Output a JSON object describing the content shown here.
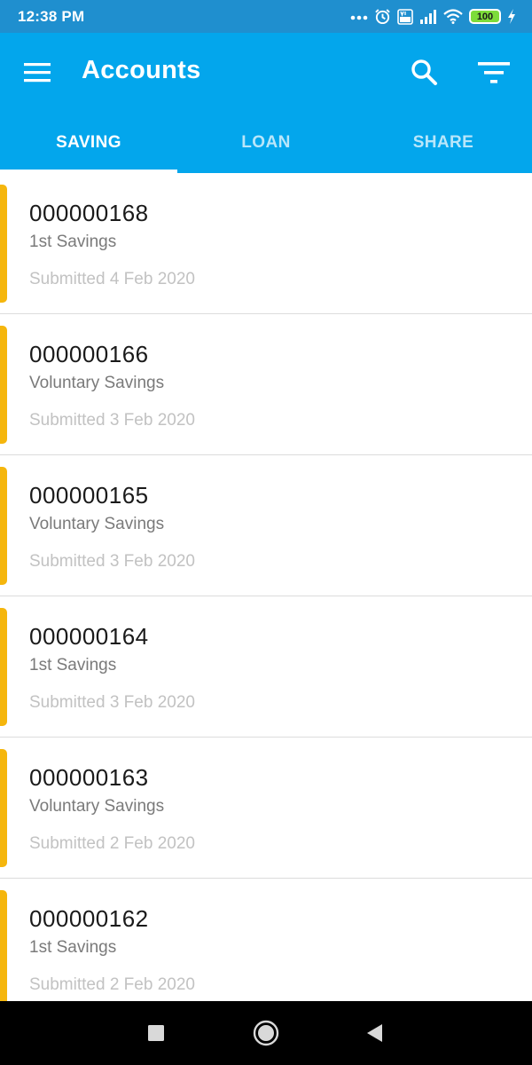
{
  "status_bar": {
    "time": "12:38 PM",
    "battery": "100",
    "icons": [
      "more-dots-icon",
      "alarm-icon",
      "volte-icon",
      "signal-icon",
      "wifi-icon",
      "battery-icon",
      "charging-icon"
    ]
  },
  "app_bar": {
    "title": "Accounts",
    "color": "#03a6ec",
    "icons": [
      "menu-icon",
      "search-icon",
      "filter-icon"
    ]
  },
  "tabs": [
    {
      "label": "SAVING",
      "active": true
    },
    {
      "label": "LOAN",
      "active": false
    },
    {
      "label": "SHARE",
      "active": false
    }
  ],
  "accounts": [
    {
      "number": "000000168",
      "product": "1st Savings",
      "submitted": "Submitted 4 Feb 2020"
    },
    {
      "number": "000000166",
      "product": "Voluntary Savings",
      "submitted": "Submitted 3 Feb 2020"
    },
    {
      "number": "000000165",
      "product": "Voluntary Savings",
      "submitted": "Submitted 3 Feb 2020"
    },
    {
      "number": "000000164",
      "product": "1st Savings",
      "submitted": "Submitted 3 Feb 2020"
    },
    {
      "number": "000000163",
      "product": "Voluntary Savings",
      "submitted": "Submitted 2 Feb 2020"
    },
    {
      "number": "000000162",
      "product": "1st Savings",
      "submitted": "Submitted 2 Feb 2020"
    }
  ],
  "status_strip_color": "#f5b60d",
  "nav_bar": {
    "icons": [
      "recents-icon",
      "home-icon",
      "back-icon"
    ]
  }
}
